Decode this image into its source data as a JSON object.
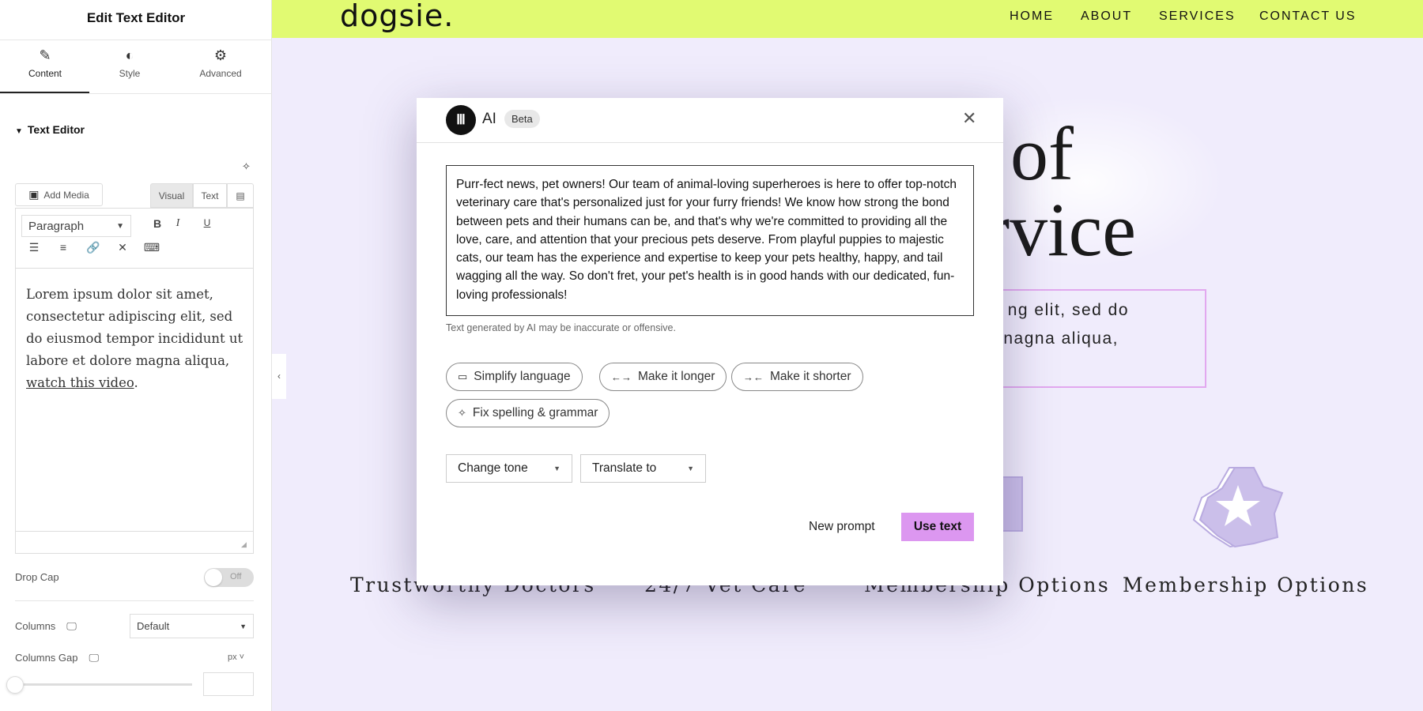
{
  "panel": {
    "title": "Edit Text Editor",
    "tabs": [
      {
        "label": "Content",
        "icon": "pencil-icon"
      },
      {
        "label": "Style",
        "icon": "contrast-icon"
      },
      {
        "label": "Advanced",
        "icon": "gear-icon"
      }
    ],
    "section": "Text Editor",
    "add_media": "Add Media",
    "mode_tabs": [
      "Visual",
      "Text"
    ],
    "format_select": "Paragraph",
    "content_text": "Lorem ipsum dolor sit amet, consectetur adipiscing elit, sed do eiusmod tempor incididunt ut labore et dolore magna aliqua, ",
    "content_link": "watch this video",
    "content_end": ".",
    "drop_cap": {
      "label": "Drop Cap",
      "state": "Off"
    },
    "columns": {
      "label": "Columns",
      "value": "Default"
    },
    "columns_gap": {
      "label": "Columns Gap",
      "unit": "px",
      "value": ""
    }
  },
  "site": {
    "logo": "dogsie.",
    "nav": [
      "HOME",
      "ABOUT",
      "SERVICES",
      "CONTACT US"
    ],
    "hero_line1": "of",
    "hero_line2": "rvice",
    "body_line1": "ng elit, sed do",
    "body_line2": "nagna aliqua,",
    "features": [
      "Trustworthy Doctors",
      "24/7 Vet Care",
      "Membership Options",
      "Membership Options"
    ],
    "colors": {
      "header": "#e1fa72",
      "background": "#f0ecfc",
      "accent": "#dc97f0"
    }
  },
  "ai_modal": {
    "title": "AI",
    "badge": "Beta",
    "generated_text": "Purr-fect news, pet owners! Our team of animal-loving superheroes is here to offer top-notch veterinary care that's personalized just for your furry friends! We know how strong the bond between pets and their humans can be, and that's why we're committed to providing all the love, care, and attention that your precious pets deserve. From playful puppies to majestic cats, our team has the experience and expertise to keep your pets healthy, happy, and tail wagging all the way. So don't fret, your pet's health is in good hands with our dedicated, fun-loving professionals!",
    "disclaimer": "Text generated by AI may be inaccurate or offensive.",
    "chips": [
      "Simplify language",
      "Make it longer",
      "Make it shorter",
      "Fix spelling & grammar"
    ],
    "change_tone": "Change tone",
    "translate": "Translate to",
    "new_prompt": "New prompt",
    "use_text": "Use text"
  }
}
